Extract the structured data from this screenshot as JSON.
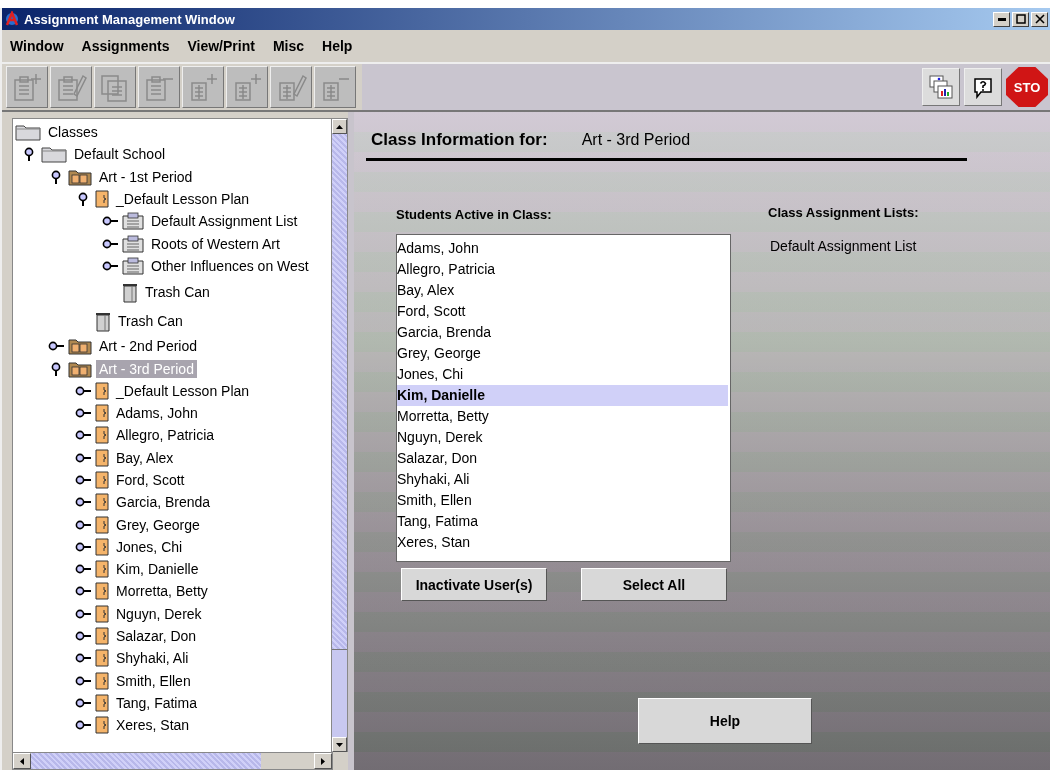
{
  "window": {
    "title": "Assignment Management Window"
  },
  "menu": [
    "Window",
    "Assignments",
    "View/Print",
    "Misc",
    "Help"
  ],
  "toolbar": {
    "left": [
      {
        "kind": "clipboard_add",
        "disabled": true
      },
      {
        "kind": "clipboard_edit",
        "disabled": true
      },
      {
        "kind": "clipboards",
        "disabled": true
      },
      {
        "kind": "clipboard_remove",
        "disabled": true
      },
      {
        "kind": "page_add",
        "disabled": true
      },
      {
        "kind": "page_add",
        "disabled": true
      },
      {
        "kind": "page_edit",
        "disabled": true
      },
      {
        "kind": "page_remove",
        "disabled": true
      }
    ],
    "right": [
      {
        "kind": "charts"
      },
      {
        "kind": "help"
      },
      {
        "kind": "stop",
        "label": "STO"
      }
    ]
  },
  "tree": [
    {
      "label": "Classes",
      "kind": "folder",
      "selected": false,
      "children": [
        {
          "label": "Default School",
          "kind": "folder",
          "expanded": true,
          "selected": false,
          "children": [
            {
              "label": "Art - 1st Period",
              "kind": "class",
              "expanded": true,
              "selected": false,
              "children": [
                {
                  "label": "_Default Lesson Plan",
                  "kind": "person",
                  "expanded": true,
                  "selected": false,
                  "children": [
                    {
                      "label": "Default Assignment List",
                      "kind": "list",
                      "expanded": false,
                      "selected": false
                    },
                    {
                      "label": "Roots of Western Art",
                      "kind": "list",
                      "expanded": false,
                      "selected": false
                    },
                    {
                      "label": "Other Influences on West",
                      "kind": "list",
                      "expanded": false,
                      "selected": false
                    },
                    {
                      "label": "Trash Can",
                      "kind": "trash",
                      "selected": false
                    }
                  ]
                },
                {
                  "label": "Trash Can",
                  "kind": "trash",
                  "selected": false
                }
              ]
            },
            {
              "label": "Art - 2nd Period",
              "kind": "class",
              "expanded": false,
              "selected": false
            },
            {
              "label": "Art - 3rd Period",
              "kind": "class",
              "expanded": true,
              "selected": true,
              "children": [
                {
                  "label": "_Default Lesson Plan",
                  "kind": "person",
                  "expanded": false,
                  "selected": false
                },
                {
                  "label": "Adams, John",
                  "kind": "person",
                  "expanded": false,
                  "selected": false
                },
                {
                  "label": "Allegro, Patricia",
                  "kind": "person",
                  "expanded": false,
                  "selected": false
                },
                {
                  "label": "Bay, Alex",
                  "kind": "person",
                  "expanded": false,
                  "selected": false
                },
                {
                  "label": "Ford, Scott",
                  "kind": "person",
                  "expanded": false,
                  "selected": false
                },
                {
                  "label": "Garcia, Brenda",
                  "kind": "person",
                  "expanded": false,
                  "selected": false
                },
                {
                  "label": "Grey, George",
                  "kind": "person",
                  "expanded": false,
                  "selected": false
                },
                {
                  "label": "Jones, Chi",
                  "kind": "person",
                  "expanded": false,
                  "selected": false
                },
                {
                  "label": "Kim, Danielle",
                  "kind": "person",
                  "expanded": false,
                  "selected": false
                },
                {
                  "label": "Morretta, Betty",
                  "kind": "person",
                  "expanded": false,
                  "selected": false
                },
                {
                  "label": "Nguyn, Derek",
                  "kind": "person",
                  "expanded": false,
                  "selected": false
                },
                {
                  "label": "Salazar, Don",
                  "kind": "person",
                  "expanded": false,
                  "selected": false
                },
                {
                  "label": "Shyhaki, Ali",
                  "kind": "person",
                  "expanded": false,
                  "selected": false
                },
                {
                  "label": "Smith, Ellen",
                  "kind": "person",
                  "expanded": false,
                  "selected": false
                },
                {
                  "label": "Tang, Fatima",
                  "kind": "person",
                  "expanded": false,
                  "selected": false
                },
                {
                  "label": "Xeres, Stan",
                  "kind": "person",
                  "expanded": false,
                  "selected": false
                }
              ]
            }
          ]
        }
      ]
    }
  ],
  "class_info": {
    "heading": "Class Information for:",
    "class_name": "Art - 3rd Period",
    "students_label": "Students Active in Class:",
    "students": [
      {
        "name": "Adams, John",
        "selected": false
      },
      {
        "name": "Allegro, Patricia",
        "selected": false
      },
      {
        "name": "Bay, Alex",
        "selected": false
      },
      {
        "name": "Ford, Scott",
        "selected": false
      },
      {
        "name": "Garcia, Brenda",
        "selected": false
      },
      {
        "name": "Grey, George",
        "selected": false
      },
      {
        "name": "Jones, Chi",
        "selected": false
      },
      {
        "name": "Kim, Danielle",
        "selected": true
      },
      {
        "name": "Morretta, Betty",
        "selected": false
      },
      {
        "name": "Nguyn, Derek",
        "selected": false
      },
      {
        "name": "Salazar, Don",
        "selected": false
      },
      {
        "name": "Shyhaki, Ali",
        "selected": false
      },
      {
        "name": "Smith, Ellen",
        "selected": false
      },
      {
        "name": "Tang, Fatima",
        "selected": false
      },
      {
        "name": "Xeres, Stan",
        "selected": false
      }
    ],
    "list_buttons": [
      "Inactivate User(s)",
      "Select All"
    ],
    "lists_label": "Class Assignment Lists:",
    "lists": [
      "Default Assignment List"
    ],
    "help_button": "Help"
  }
}
